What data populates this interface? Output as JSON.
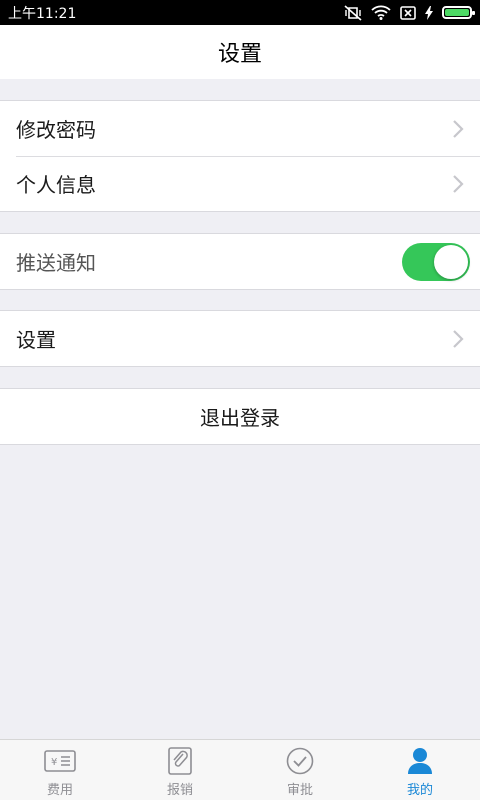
{
  "status_bar": {
    "time": "上午11:21",
    "icons": [
      "mute-vibrate-icon",
      "wifi-icon",
      "no-sim-icon",
      "charging-icon",
      "battery-icon"
    ]
  },
  "nav": {
    "title": "设置"
  },
  "groups": {
    "account": {
      "change_password": "修改密码",
      "personal_info": "个人信息"
    },
    "notification": {
      "push_label": "推送通知",
      "push_enabled": true
    },
    "settings": {
      "label": "设置"
    },
    "logout": {
      "label": "退出登录"
    }
  },
  "tabbar": {
    "items": [
      {
        "label": "费用",
        "icon": "expense-icon",
        "active": false
      },
      {
        "label": "报销",
        "icon": "reimburse-icon",
        "active": false
      },
      {
        "label": "审批",
        "icon": "approve-icon",
        "active": false
      },
      {
        "label": "我的",
        "icon": "person-icon",
        "active": true
      }
    ]
  },
  "colors": {
    "toggle_on": "#35c759",
    "tab_active": "#1a88d6",
    "tab_inactive": "#8e8e93",
    "background": "#efeff4"
  }
}
